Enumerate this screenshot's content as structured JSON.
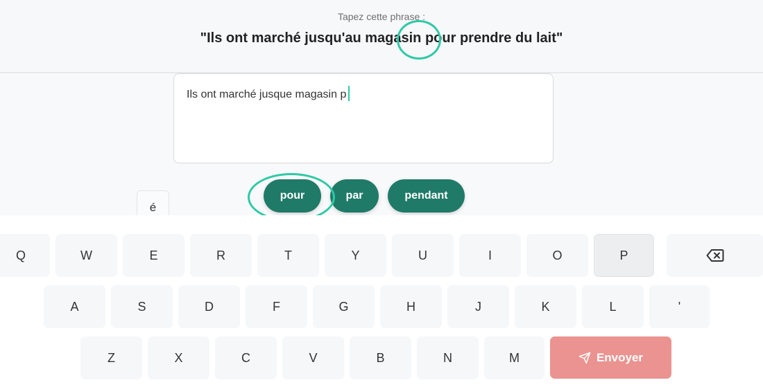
{
  "header": {
    "prompt_label": "Tapez cette phrase :",
    "phrase_before": "\"Ils ont marché jusqu'au magasin ",
    "phrase_highlight": "pour",
    "phrase_after": " prendre du lait\""
  },
  "input": {
    "value": "Ils ont marché jusque magasin p"
  },
  "suggestions": [
    "pour",
    "par",
    "pendant"
  ],
  "accent_popup": "é",
  "keyboard": {
    "row1": [
      "Q",
      "W",
      "E",
      "R",
      "T",
      "Y",
      "U",
      "I",
      "O",
      "P"
    ],
    "row2": [
      "A",
      "S",
      "D",
      "F",
      "G",
      "H",
      "J",
      "K",
      "L",
      "'"
    ],
    "row3": [
      "Z",
      "X",
      "C",
      "V",
      "B",
      "N",
      "M"
    ],
    "active_key": "P",
    "send_label": "Envoyer"
  },
  "colors": {
    "accent": "#2ec9a8",
    "suggestion_bg": "#207a68",
    "send_bg": "#ea9390",
    "key_bg": "#f5f7f9"
  },
  "icons": {
    "backspace": "backspace-icon",
    "send": "send-icon"
  }
}
